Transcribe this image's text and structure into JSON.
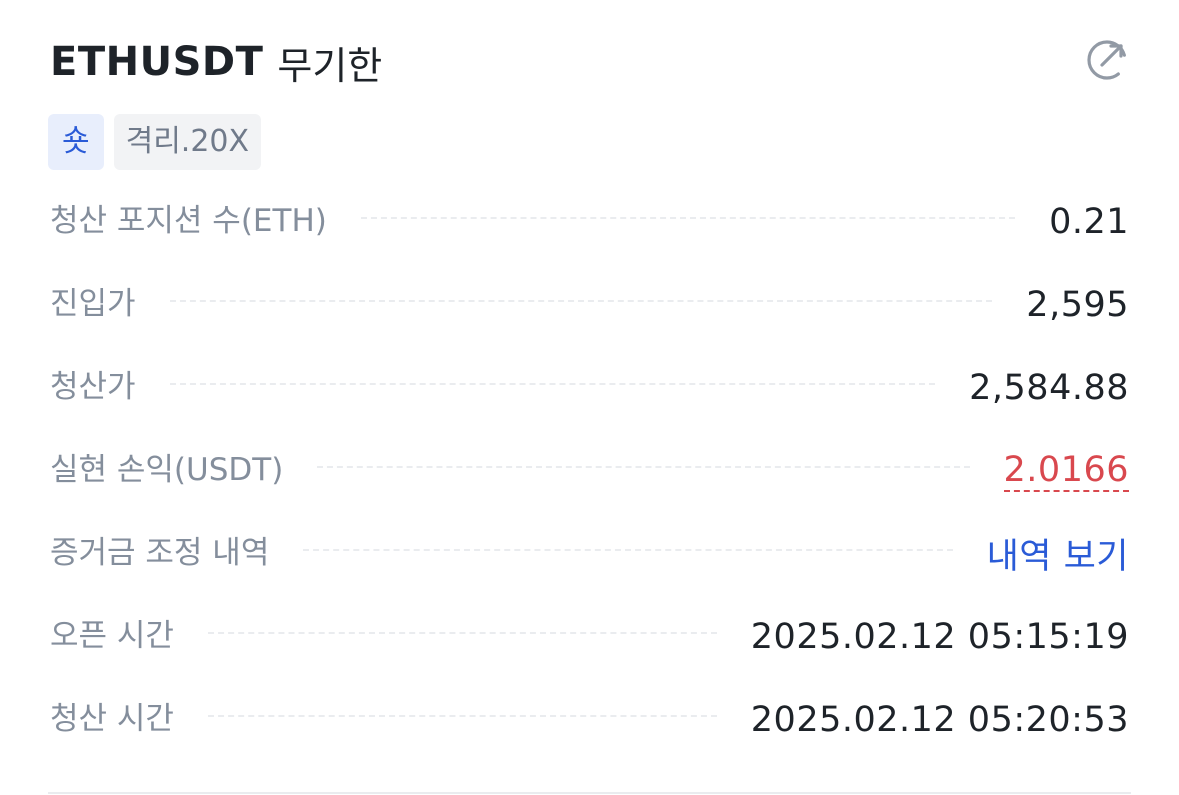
{
  "header": {
    "symbol": "ETHUSDT",
    "contract_type": "무기한",
    "share_icon": "share-external-icon"
  },
  "tags": {
    "side": "숏",
    "margin_mode": "격리.20X"
  },
  "rows": [
    {
      "label": "청산 포지션 수(ETH)",
      "value": "0.21"
    },
    {
      "label": "진입가",
      "value": "2,595"
    },
    {
      "label": "청산가",
      "value": "2,584.88"
    },
    {
      "label": "실현 손익(USDT)",
      "value": "2.0166"
    },
    {
      "label": "증거금 조정 내역",
      "value": "내역 보기"
    },
    {
      "label": "오픈 시간",
      "value": "2025.02.12 05:15:19"
    },
    {
      "label": "청산 시간",
      "value": "2025.02.12 05:20:53"
    }
  ],
  "colors": {
    "accent_blue": "#2a5bd7",
    "loss_red": "#d9484e",
    "label_gray": "#848e9c",
    "text_dark": "#1e2329"
  }
}
